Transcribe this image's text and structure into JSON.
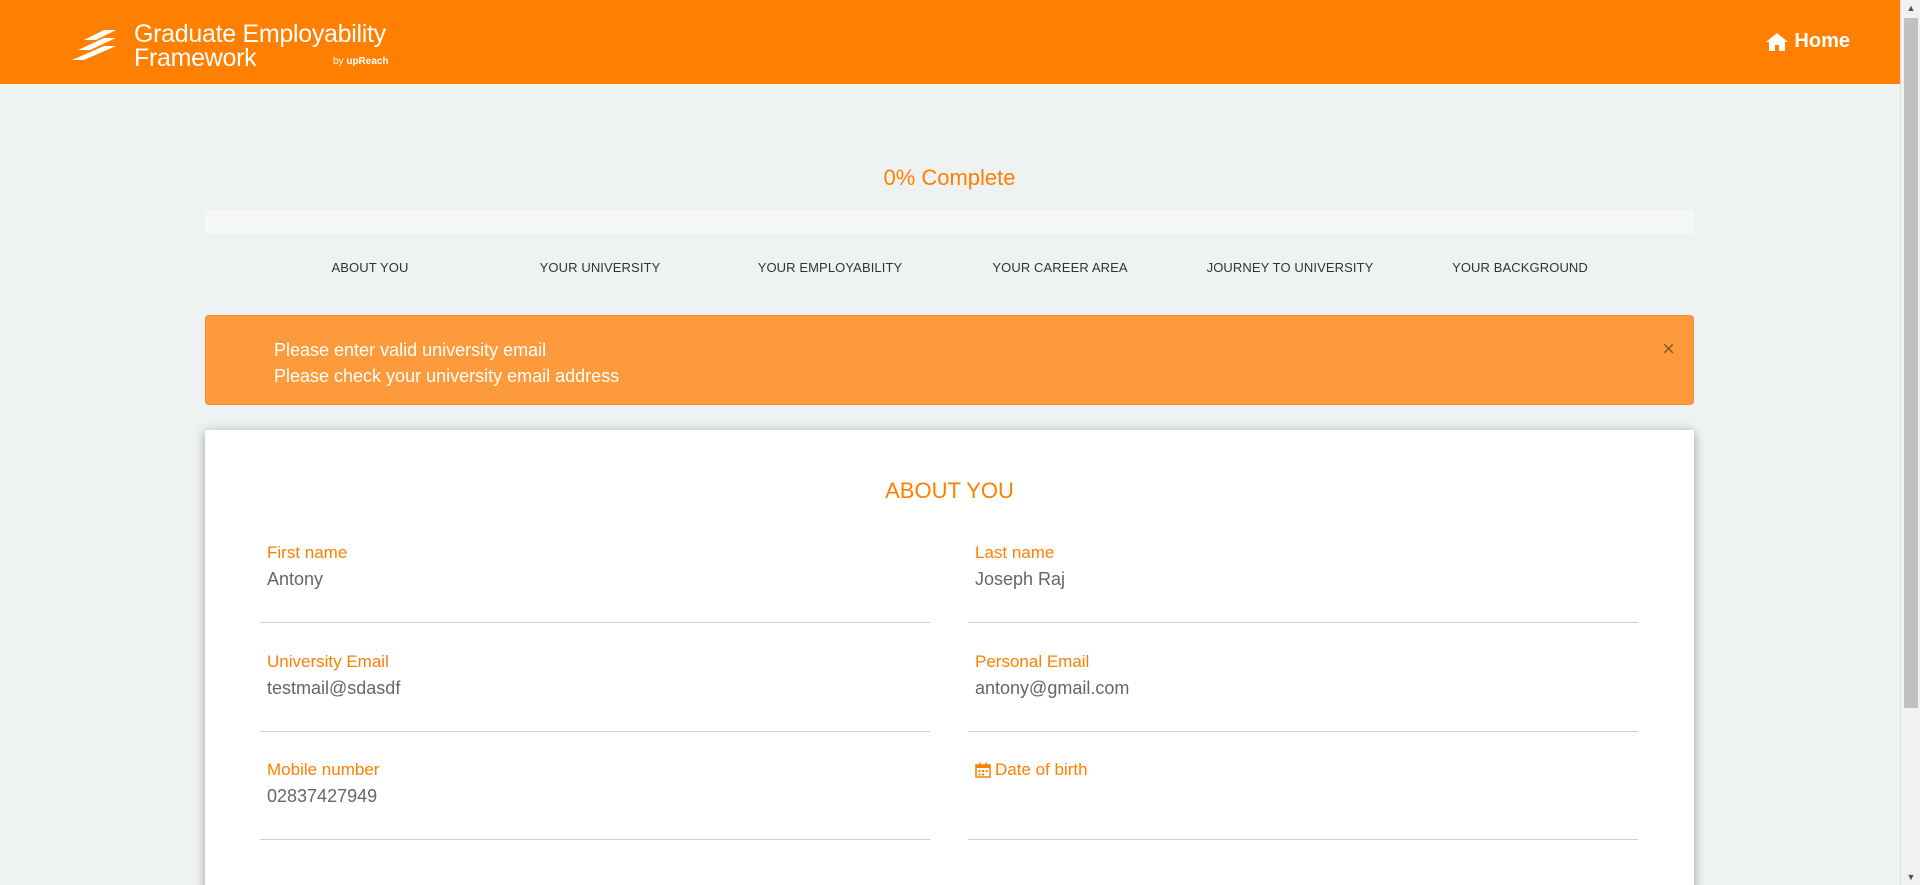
{
  "header": {
    "logo_line1": "Graduate Employability",
    "logo_line2": "Framework",
    "logo_by": "by",
    "logo_by_brand": "upReach",
    "home_label": "Home"
  },
  "progress": {
    "label": "0% Complete",
    "percent": 0
  },
  "steps": [
    {
      "label": "ABOUT YOU"
    },
    {
      "label": "YOUR UNIVERSITY"
    },
    {
      "label": "YOUR EMPLOYABILITY"
    },
    {
      "label": "YOUR CAREER AREA"
    },
    {
      "label": "JOURNEY TO UNIVERSITY"
    },
    {
      "label": "YOUR BACKGROUND"
    }
  ],
  "alert": {
    "lines": [
      "Please enter valid university email",
      "Please check your university email address"
    ],
    "close": "×"
  },
  "form": {
    "title": "ABOUT YOU",
    "fields": [
      {
        "label": "First name",
        "value": "Antony"
      },
      {
        "label": "Last name",
        "value": "Joseph Raj"
      },
      {
        "label": "University Email",
        "value": "testmail@sdasdf"
      },
      {
        "label": "Personal Email",
        "value": "antony@gmail.com"
      },
      {
        "label": "Mobile number",
        "value": "02837427949"
      },
      {
        "label": "Date of birth",
        "value": ""
      }
    ]
  },
  "colors": {
    "brand": "#ff7f00",
    "alert": "#fd9a3c",
    "background": "#eff2f3"
  },
  "icons": {
    "home": "home-icon",
    "calendar": "calendar-icon",
    "close": "close-icon",
    "logo": "logo-stripes-icon"
  }
}
